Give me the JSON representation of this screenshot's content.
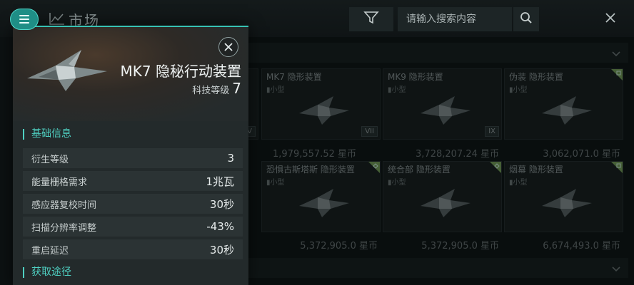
{
  "topbar": {
    "title": "市场",
    "search_placeholder": "请输入搜索内容",
    "icons": {
      "menu": "menu-icon",
      "market": "trend-line-icon",
      "filter": "filter-icon",
      "search": "search-icon",
      "close": "close-icon"
    }
  },
  "detail": {
    "item_name": "MK7 隐秘行动装置",
    "tech_label": "科技等级",
    "tech_level": "7",
    "basic_info_header": "基础信息",
    "stats": [
      {
        "label": "衍生等级",
        "value": "3"
      },
      {
        "label": "能量栅格需求",
        "value": "1兆瓦"
      },
      {
        "label": "感应器复校时间",
        "value": "30秒"
      },
      {
        "label": "扫描分辨率调整",
        "value": "-43%"
      },
      {
        "label": "重启延迟",
        "value": "30秒"
      }
    ],
    "acquire_header": "获取途径"
  },
  "grid": {
    "row1": [
      {
        "name": "MK7 隐形装置",
        "size": "小型",
        "badge": "VII",
        "price": "1,979,557.52 星币"
      },
      {
        "name": "MK9 隐形装置",
        "size": "小型",
        "badge": "IX",
        "price": "3,728,207.24 星币"
      },
      {
        "name": "伪装 隐形装置",
        "size": "小型",
        "badge": "",
        "price": "3,062,071.0 星币"
      }
    ],
    "row2": [
      {
        "name": "恐惧古斯塔斯 隐形装置",
        "size": "小型",
        "price": "5,372,905.0 星币"
      },
      {
        "name": "统合部 隐形装置",
        "size": "小型",
        "price": "5,372,905.0 星币"
      },
      {
        "name": "烟幕 隐形装置",
        "size": "小型",
        "price": "6,674,493.0 星币"
      }
    ],
    "partial_badge": "V"
  },
  "colors": {
    "accent": "#37c2b4",
    "panel": "#232a2b",
    "background": "#0c1112"
  }
}
